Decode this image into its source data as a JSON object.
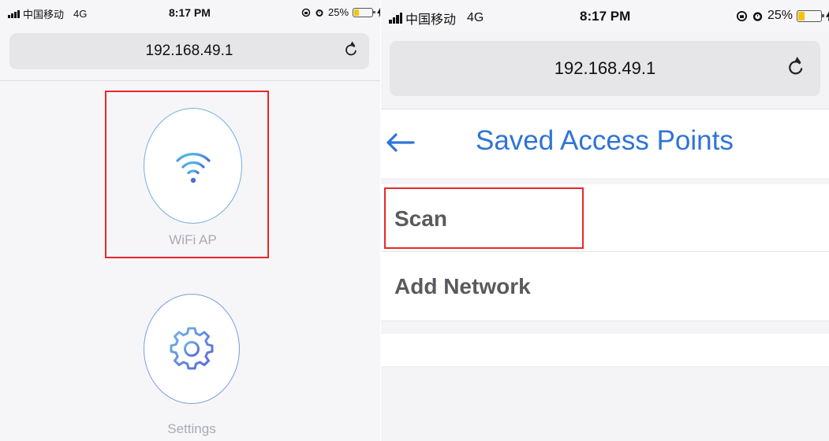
{
  "left_screen": {
    "status_bar": {
      "carrier": "中国移动",
      "network": "4G",
      "time": "8:17 PM",
      "battery": "25%"
    },
    "url_bar": {
      "url": "192.168.49.1"
    },
    "buttons": [
      {
        "label": "WiFi AP",
        "icon": "wifi-icon"
      },
      {
        "label": "Settings",
        "icon": "gear-icon"
      }
    ]
  },
  "right_screen": {
    "status_bar": {
      "carrier": "中国移动",
      "network": "4G",
      "time": "8:17 PM",
      "battery": "25%"
    },
    "url_bar": {
      "url": "192.168.49.1"
    },
    "header": {
      "back_icon": "arrow-left-icon",
      "title": "Saved Access Points"
    },
    "menu_items": [
      {
        "label": "Scan"
      },
      {
        "label": "Add Network"
      }
    ]
  },
  "colors": {
    "accent": "#2f74d6",
    "highlight_box": "#e8282b",
    "battery_fill": "#f5c400",
    "muted_label": "#a9aab8",
    "list_text": "#5a5a5e"
  }
}
